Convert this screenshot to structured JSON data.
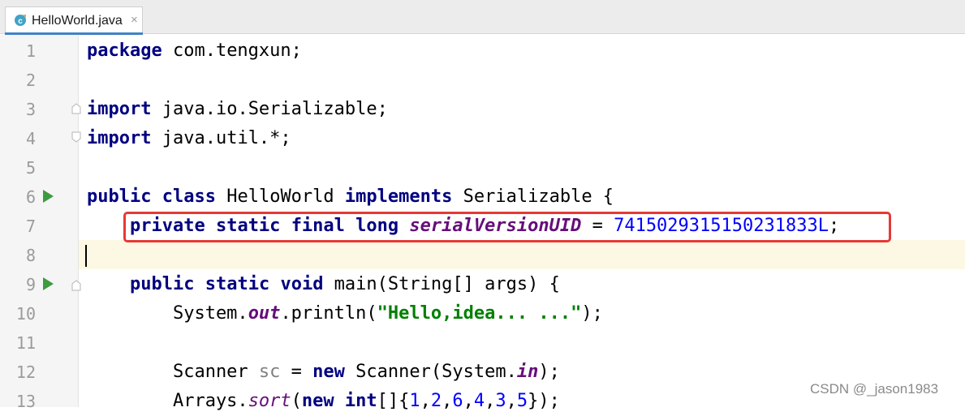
{
  "tab": {
    "filename": "HelloWorld.java",
    "close": "×"
  },
  "lines": [
    {
      "num": "1",
      "tokens": [
        "package",
        " com.tengxun;"
      ]
    },
    {
      "num": "2"
    },
    {
      "num": "3",
      "tokens": [
        "import",
        " java.io.Serializable;"
      ]
    },
    {
      "num": "4",
      "tokens": [
        "import",
        " java.util.*;"
      ]
    },
    {
      "num": "5"
    },
    {
      "num": "6",
      "tokens": [
        "public",
        " ",
        "class",
        " HelloWorld ",
        "implements",
        " Serializable {"
      ]
    },
    {
      "num": "7",
      "tokens": [
        "    ",
        "private",
        " ",
        "static",
        " ",
        "final",
        " ",
        "long",
        " ",
        "serialVersionUID",
        " = ",
        "7415029315150231833L",
        ";"
      ]
    },
    {
      "num": "8"
    },
    {
      "num": "9",
      "tokens": [
        "    ",
        "public",
        " ",
        "static",
        " ",
        "void",
        " main(String[] args) {"
      ]
    },
    {
      "num": "10",
      "tokens": [
        "        System.",
        "out",
        ".println(",
        "\"Hello,idea... ...\"",
        ");"
      ]
    },
    {
      "num": "11"
    },
    {
      "num": "12",
      "tokens": [
        "        Scanner ",
        "sc",
        " = ",
        "new",
        " Scanner(System.",
        "in",
        ");"
      ]
    },
    {
      "num": "13",
      "tokens": [
        "        Arrays.",
        "sort",
        "(",
        "new",
        " ",
        "int",
        "[]{",
        "1",
        ",",
        "2",
        ",",
        "6",
        ",",
        "4",
        ",",
        "3",
        ",",
        "5",
        "});"
      ]
    }
  ],
  "watermark": "CSDN @_jason1983",
  "colors": {
    "keyword": "#000080",
    "static_field": "#660e7a",
    "number": "#0000ff",
    "string": "#008000",
    "highlight_border": "#e53935",
    "run_icon": "#3f9a3f",
    "caret_line": "#fdf8e3"
  },
  "icons": {
    "tab_icon": "java-class-icon",
    "run": "run-icon",
    "fold": "fold-icon"
  }
}
